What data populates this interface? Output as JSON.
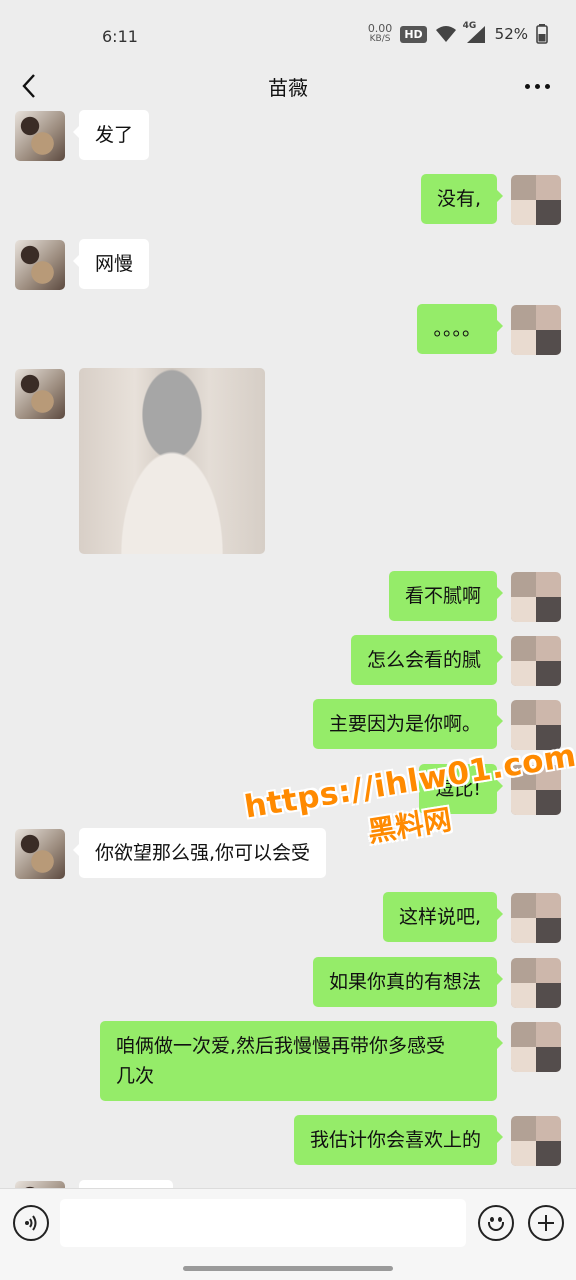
{
  "status": {
    "time": "6:11",
    "net_speed_value": "0.00",
    "net_speed_unit": "KB/S",
    "hd": "HD",
    "signal_label": "4G",
    "battery": "52%"
  },
  "header": {
    "title": "苗薇",
    "back_icon": "chevron-left-icon",
    "more_icon": "more-dots-icon"
  },
  "messages": [
    {
      "side": "left",
      "type": "text",
      "text": "发了"
    },
    {
      "side": "right",
      "type": "text",
      "text": "没有,"
    },
    {
      "side": "left",
      "type": "text",
      "text": "网慢"
    },
    {
      "side": "right",
      "type": "text",
      "text": "。。。。"
    },
    {
      "side": "left",
      "type": "image"
    },
    {
      "side": "right",
      "type": "text",
      "text": "看不腻啊"
    },
    {
      "side": "right",
      "type": "text",
      "text": "怎么会看的腻"
    },
    {
      "side": "right",
      "type": "text",
      "text": "主要因为是你啊。"
    },
    {
      "side": "right",
      "type": "text",
      "text": "逗比!"
    },
    {
      "side": "left",
      "type": "text",
      "text": "你欲望那么强,你可以会受"
    },
    {
      "side": "right",
      "type": "text",
      "text": "这样说吧,"
    },
    {
      "side": "right",
      "type": "text",
      "text": "如果你真的有想法"
    },
    {
      "side": "right",
      "type": "text",
      "text": "咱俩做一次爱,然后我慢慢再带你多感受\n几次"
    },
    {
      "side": "right",
      "type": "text",
      "text": "我估计你会喜欢上的"
    }
  ],
  "watermark": {
    "url": "https://ihlw01.com",
    "brand": "黑料网"
  },
  "input_bar": {
    "voice_icon": "voice-icon",
    "emoji_icon": "emoji-icon",
    "plus_icon": "plus-icon"
  }
}
